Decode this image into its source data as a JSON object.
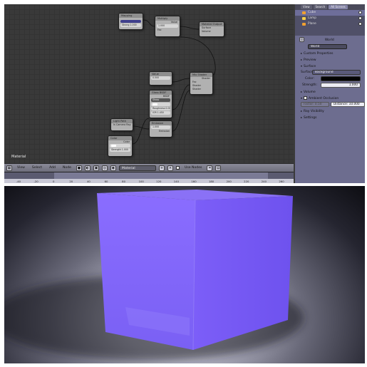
{
  "node_editor": {
    "tree_name": "Material",
    "header": {
      "menus": [
        "View",
        "Select",
        "Add",
        "Node"
      ],
      "tree_type": "Material",
      "use_nodes_label": "Use Nodes"
    },
    "timeline_ticks": [
      "-40",
      "-20",
      "0",
      "20",
      "40",
      "60",
      "80",
      "100",
      "120",
      "140",
      "160",
      "180",
      "200",
      "220",
      "240",
      "260"
    ]
  },
  "properties": {
    "top_tabs": [
      "View",
      "Search",
      "All Scenes"
    ],
    "outliner": [
      "Cube",
      "Lamp",
      "Plane"
    ],
    "world_tab_label": "World",
    "world_name": "World",
    "sections": {
      "custom_properties": "Custom Properties",
      "preview": "Preview",
      "surface": "Surface",
      "volume": "Volume",
      "ambient_occlusion": "Ambient Occlusion",
      "ray_visibility": "Ray Visibility",
      "settings": "Settings"
    },
    "surface_label": "Surface:",
    "surface_value": "Background",
    "color_label": "Color:",
    "strength_label": "Strength:",
    "strength_value": "1.000",
    "factor_label": "Factor:",
    "factor_value": "0.50",
    "distance_label": "Distance:",
    "distance_value": "10.000"
  },
  "colors": {
    "emission_purple": "#7a5cff",
    "panel_blue": "#6d6d8f"
  }
}
